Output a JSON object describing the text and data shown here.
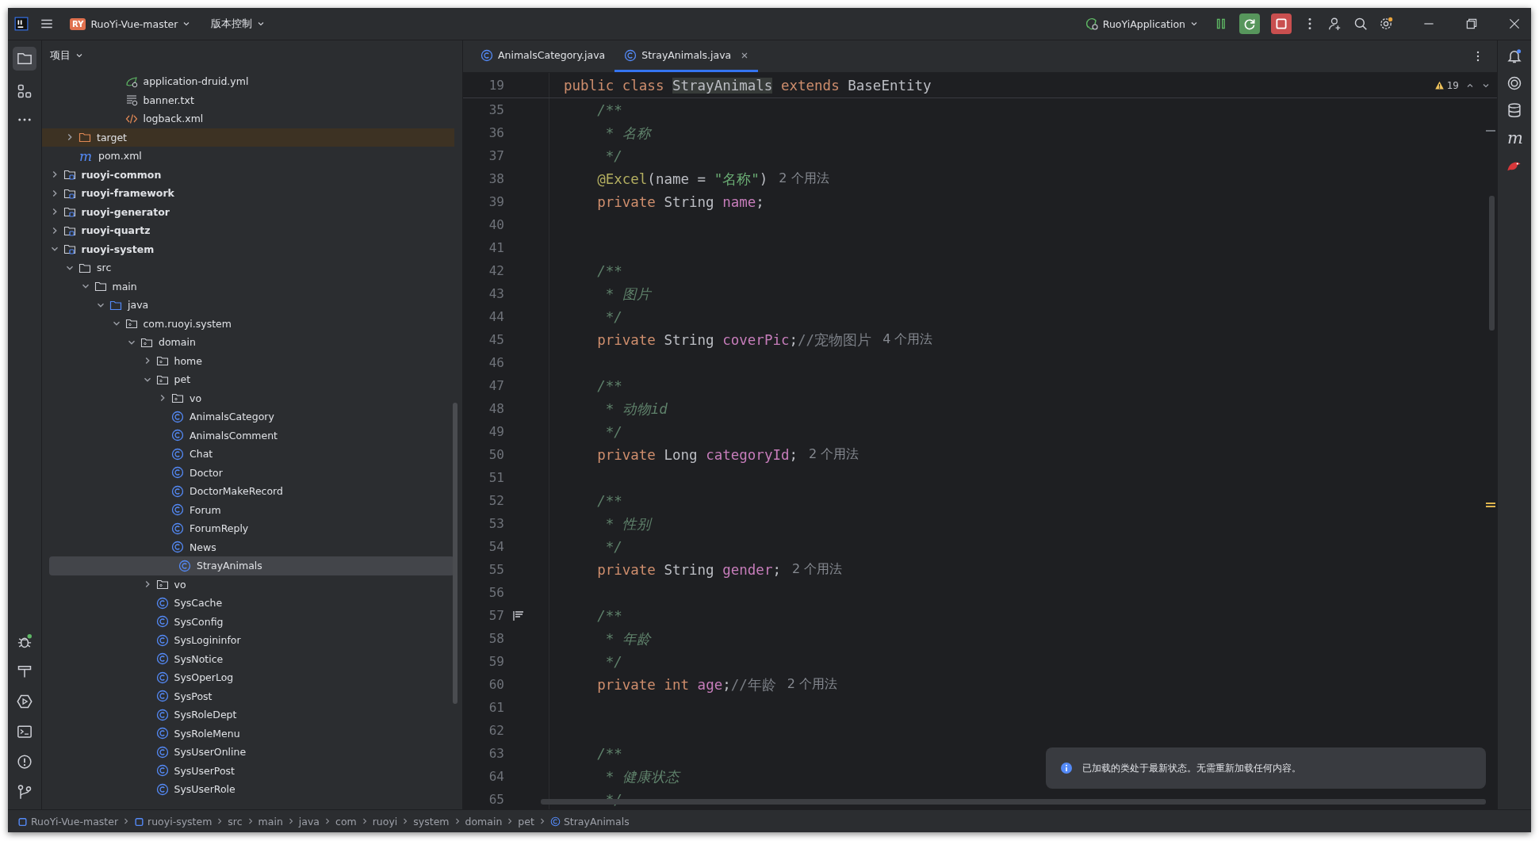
{
  "title_bar": {
    "project_badge": "RY",
    "project": "RuoYi-Vue-master",
    "vcs": "版本控制",
    "run_config": "RuoYiApplication"
  },
  "project_panel": {
    "title": "项目"
  },
  "tree": [
    {
      "children": [
        {
          "children": [
            {
              "children": [
                {
                  "children": [
                    {
                      "label": "application-druid.yml",
                      "kind": "yml",
                      "selected": false
                    },
                    {
                      "label": "banner.txt",
                      "kind": "txt",
                      "selected": false
                    },
                    {
                      "label": "logback.xml",
                      "kind": "xml",
                      "selected": false
                    }
                  ]
                }
              ]
            }
          ]
        },
        {
          "label": "target",
          "kind": "excluded",
          "expanded": false,
          "selected": false
        },
        {
          "label": "pom.xml",
          "kind": "maven",
          "glyph": "m",
          "selected": false
        }
      ]
    },
    {
      "label": "ruoyi-common",
      "kind": "module",
      "expanded": false,
      "selected": false
    },
    {
      "label": "ruoyi-framework",
      "kind": "module",
      "expanded": false,
      "selected": false
    },
    {
      "label": "ruoyi-generator",
      "kind": "module",
      "expanded": false,
      "selected": false
    },
    {
      "label": "ruoyi-quartz",
      "kind": "module",
      "expanded": false,
      "selected": false
    },
    {
      "label": "ruoyi-system",
      "kind": "module",
      "expanded": true,
      "selected": false,
      "children": [
        {
          "label": "src",
          "kind": "folder",
          "expanded": true,
          "selected": false,
          "children": [
            {
              "label": "main",
              "kind": "folder",
              "expanded": true,
              "selected": false,
              "children": [
                {
                  "label": "java",
                  "kind": "source",
                  "expanded": true,
                  "selected": false,
                  "children": [
                    {
                      "label": "com.ruoyi.system",
                      "kind": "package",
                      "expanded": true,
                      "selected": false,
                      "children": [
                        {
                          "label": "domain",
                          "kind": "package",
                          "expanded": true,
                          "selected": false,
                          "children": [
                            {
                              "label": "home",
                              "kind": "package",
                              "expanded": false,
                              "selected": false
                            },
                            {
                              "label": "pet",
                              "kind": "package",
                              "expanded": true,
                              "selected": false,
                              "children": [
                                {
                                  "label": "vo",
                                  "kind": "package",
                                  "expanded": false,
                                  "selected": false
                                },
                                {
                                  "label": "AnimalsCategory",
                                  "kind": "class",
                                  "selected": false
                                },
                                {
                                  "label": "AnimalsComment",
                                  "kind": "class",
                                  "selected": false
                                },
                                {
                                  "label": "Chat",
                                  "kind": "class",
                                  "selected": false
                                },
                                {
                                  "label": "Doctor",
                                  "kind": "class",
                                  "selected": false
                                },
                                {
                                  "label": "DoctorMakeRecord",
                                  "kind": "class",
                                  "selected": false
                                },
                                {
                                  "label": "Forum",
                                  "kind": "class",
                                  "selected": false
                                },
                                {
                                  "label": "ForumReply",
                                  "kind": "class",
                                  "selected": false
                                },
                                {
                                  "label": "News",
                                  "kind": "class",
                                  "selected": false
                                },
                                {
                                  "label": "StrayAnimals",
                                  "kind": "class",
                                  "selected": true
                                }
                              ]
                            },
                            {
                              "label": "vo",
                              "kind": "package",
                              "expanded": false,
                              "selected": false
                            },
                            {
                              "label": "SysCache",
                              "kind": "class",
                              "selected": false
                            },
                            {
                              "label": "SysConfig",
                              "kind": "class",
                              "selected": false
                            },
                            {
                              "label": "SysLogininfor",
                              "kind": "class",
                              "selected": false
                            },
                            {
                              "label": "SysNotice",
                              "kind": "class",
                              "selected": false
                            },
                            {
                              "label": "SysOperLog",
                              "kind": "class",
                              "selected": false
                            },
                            {
                              "label": "SysPost",
                              "kind": "class",
                              "selected": false
                            },
                            {
                              "label": "SysRoleDept",
                              "kind": "class",
                              "selected": false
                            },
                            {
                              "label": "SysRoleMenu",
                              "kind": "class",
                              "selected": false
                            },
                            {
                              "label": "SysUserOnline",
                              "kind": "class",
                              "selected": false
                            },
                            {
                              "label": "SysUserPost",
                              "kind": "class",
                              "selected": false
                            },
                            {
                              "label": "SysUserRole",
                              "kind": "class",
                              "selected": false
                            }
                          ]
                        }
                      ]
                    }
                  ]
                }
              ]
            }
          ]
        }
      ]
    }
  ],
  "tabs": [
    {
      "label": "AnimalsCategory.java",
      "selected": false
    },
    {
      "label": "StrayAnimals.java",
      "selected": true
    }
  ],
  "inspections": {
    "warnings": "19"
  },
  "sticky_line": {
    "number": "19",
    "tokens": [
      {
        "kind": "kw",
        "text": "public class "
      },
      {
        "kind": "hl",
        "text": "StrayAnimals"
      },
      {
        "kind": "kw",
        "text": " extends "
      },
      {
        "kind": "plain",
        "text": "BaseEntity"
      }
    ]
  },
  "code": [
    {
      "number": "35",
      "tokens": [
        {
          "kind": "doc",
          "text": "/**"
        }
      ]
    },
    {
      "number": "36",
      "tokens": [
        {
          "kind": "doc-cont",
          "text": "* 名称"
        }
      ]
    },
    {
      "number": "37",
      "tokens": [
        {
          "kind": "doc-cont",
          "text": "*/"
        }
      ]
    },
    {
      "number": "38",
      "tokens": [
        {
          "kind": "ann",
          "text": "@Excel"
        },
        {
          "kind": "plain",
          "text": "(name = "
        },
        {
          "kind": "str",
          "text": "\"名称\""
        },
        {
          "kind": "plain",
          "text": ")"
        }
      ],
      "hint": "2 个用法"
    },
    {
      "number": "39",
      "tokens": [
        {
          "kind": "kw",
          "text": "private "
        },
        {
          "kind": "plain",
          "text": "String "
        },
        {
          "kind": "field",
          "text": "name"
        },
        {
          "kind": "plain",
          "text": ";"
        }
      ]
    },
    {
      "number": "40"
    },
    {
      "number": "41"
    },
    {
      "number": "42",
      "tokens": [
        {
          "kind": "doc",
          "text": "/**"
        }
      ]
    },
    {
      "number": "43",
      "tokens": [
        {
          "kind": "doc-cont",
          "text": "* 图片"
        }
      ]
    },
    {
      "number": "44",
      "tokens": [
        {
          "kind": "doc-cont",
          "text": "*/"
        }
      ]
    },
    {
      "number": "45",
      "tokens": [
        {
          "kind": "kw",
          "text": "private "
        },
        {
          "kind": "plain",
          "text": "String "
        },
        {
          "kind": "field",
          "text": "coverPic"
        },
        {
          "kind": "plain",
          "text": ";"
        },
        {
          "kind": "cmt",
          "text": "//宠物图片"
        }
      ],
      "hint": "4 个用法"
    },
    {
      "number": "46"
    },
    {
      "number": "47",
      "tokens": [
        {
          "kind": "doc",
          "text": "/**"
        }
      ]
    },
    {
      "number": "48",
      "tokens": [
        {
          "kind": "doc-cont",
          "text": "* 动物id"
        }
      ]
    },
    {
      "number": "49",
      "tokens": [
        {
          "kind": "doc-cont",
          "text": "*/"
        }
      ]
    },
    {
      "number": "50",
      "tokens": [
        {
          "kind": "kw",
          "text": "private "
        },
        {
          "kind": "plain",
          "text": "Long "
        },
        {
          "kind": "field",
          "text": "categoryId"
        },
        {
          "kind": "plain",
          "text": ";"
        }
      ],
      "hint": "2 个用法"
    },
    {
      "number": "51"
    },
    {
      "number": "52",
      "tokens": [
        {
          "kind": "doc",
          "text": "/**"
        }
      ]
    },
    {
      "number": "53",
      "tokens": [
        {
          "kind": "doc-cont",
          "text": "* 性别"
        }
      ]
    },
    {
      "number": "54",
      "tokens": [
        {
          "kind": "doc-cont",
          "text": "*/"
        }
      ]
    },
    {
      "number": "55",
      "tokens": [
        {
          "kind": "kw",
          "text": "private "
        },
        {
          "kind": "plain",
          "text": "String "
        },
        {
          "kind": "field",
          "text": "gender"
        },
        {
          "kind": "plain",
          "text": ";"
        }
      ],
      "hint": "2 个用法"
    },
    {
      "number": "56"
    },
    {
      "number": "57",
      "tokens": [
        {
          "kind": "doc",
          "text": "/**"
        }
      ],
      "doc_render": true
    },
    {
      "number": "58",
      "tokens": [
        {
          "kind": "doc-cont",
          "text": "* 年龄"
        }
      ]
    },
    {
      "number": "59",
      "tokens": [
        {
          "kind": "doc-cont",
          "text": "*/"
        }
      ]
    },
    {
      "number": "60",
      "tokens": [
        {
          "kind": "kw",
          "text": "private "
        },
        {
          "kind": "kw",
          "text": "int "
        },
        {
          "kind": "field",
          "text": "age"
        },
        {
          "kind": "plain",
          "text": ";"
        },
        {
          "kind": "cmt",
          "text": "//年龄"
        }
      ],
      "hint": "2 个用法"
    },
    {
      "number": "61"
    },
    {
      "number": "62"
    },
    {
      "number": "63",
      "tokens": [
        {
          "kind": "doc",
          "text": "/**"
        }
      ]
    },
    {
      "number": "64",
      "tokens": [
        {
          "kind": "doc-cont",
          "text": "* 健康状态"
        }
      ]
    },
    {
      "number": "65",
      "tokens": [
        {
          "kind": "doc-cont",
          "text": "*/"
        }
      ]
    }
  ],
  "right_toolbar": {
    "maven_glyph": "m"
  },
  "notification": {
    "text": "已加载的类处于最新状态。无需重新加载任何内容。"
  },
  "breadcrumbs": [
    {
      "label": "RuoYi-Vue-master",
      "kind": "module"
    },
    {
      "label": "ruoyi-system",
      "kind": "module"
    },
    {
      "label": "src",
      "kind": "plain"
    },
    {
      "label": "main",
      "kind": "plain"
    },
    {
      "label": "java",
      "kind": "plain"
    },
    {
      "label": "com",
      "kind": "plain"
    },
    {
      "label": "ruoyi",
      "kind": "plain"
    },
    {
      "label": "system",
      "kind": "plain"
    },
    {
      "label": "domain",
      "kind": "plain"
    },
    {
      "label": "pet",
      "kind": "plain"
    },
    {
      "label": "StrayAnimals",
      "kind": "class"
    }
  ]
}
